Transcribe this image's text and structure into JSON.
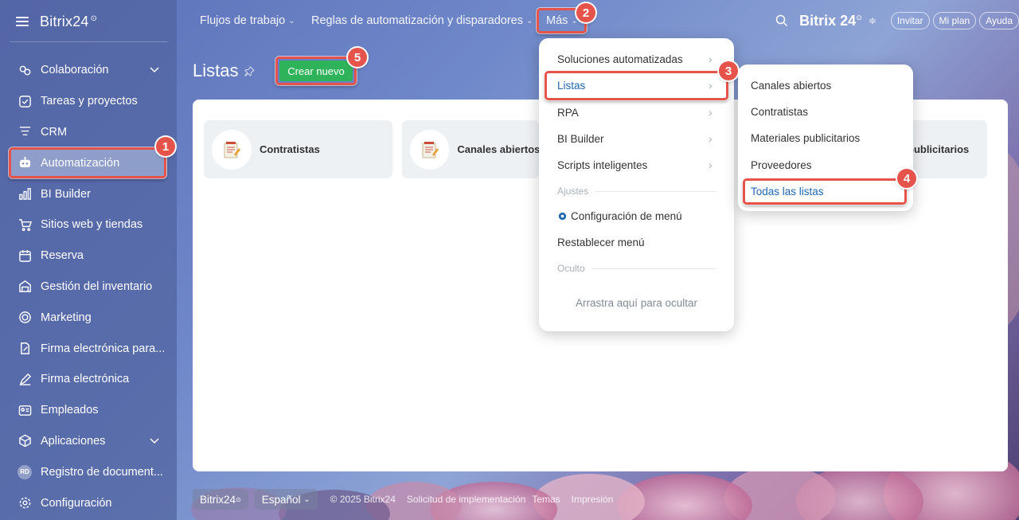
{
  "brand": {
    "name": "Bitrix24"
  },
  "sidebar": {
    "items": [
      {
        "label": "Colaboración",
        "icon": "chat-bubbles-icon"
      },
      {
        "label": "Tareas y proyectos",
        "icon": "checkbox-icon"
      },
      {
        "label": "CRM",
        "icon": "crm-filter-icon"
      },
      {
        "label": "Automatización",
        "icon": "robot-icon"
      },
      {
        "label": "BI Builder",
        "icon": "bar-chart-icon"
      },
      {
        "label": "Sitios web y tiendas",
        "icon": "cart-icon"
      },
      {
        "label": "Reserva",
        "icon": "calendar-icon"
      },
      {
        "label": "Gestión del inventario",
        "icon": "warehouse-icon"
      },
      {
        "label": "Marketing",
        "icon": "target-icon"
      },
      {
        "label": "Firma electrónica para...",
        "icon": "document-sign-icon"
      },
      {
        "label": "Firma electrónica",
        "icon": "pen-icon"
      },
      {
        "label": "Empleados",
        "icon": "id-card-icon"
      },
      {
        "label": "Aplicaciones",
        "icon": "cube-icon"
      },
      {
        "label": "Registro de document...",
        "icon": "rd-badge-icon",
        "badge": "RD"
      },
      {
        "label": "Configuración",
        "icon": "gear-icon"
      }
    ]
  },
  "topbar": {
    "links": [
      "Flujos de trabajo",
      "Reglas de automatización y disparadores",
      "Más"
    ],
    "brand": "Bitrix 24",
    "buttons": [
      "Invitar",
      "Mi plan",
      "Ayuda"
    ]
  },
  "page": {
    "title": "Listas",
    "create_label": "Crear nuevo"
  },
  "lists": [
    {
      "label": "Contratistas"
    },
    {
      "label": "Canales abiertos"
    },
    {
      "label": "publicitarios"
    }
  ],
  "menu": {
    "items": [
      {
        "label": "Soluciones automatizadas"
      },
      {
        "label": "Listas"
      },
      {
        "label": "RPA"
      },
      {
        "label": "BI Builder"
      },
      {
        "label": "Scripts inteligentes"
      }
    ],
    "section_settings": "Ajustes",
    "config_label": "Configuración de menú",
    "reset_label": "Restablecer menú",
    "section_hidden": "Oculto",
    "drag_hint": "Arrastra aquí para ocultar"
  },
  "submenu": {
    "items": [
      "Canales abiertos",
      "Contratistas",
      "Materiales publicitarios",
      "Proveedores",
      "Todas las listas"
    ]
  },
  "footer": {
    "brand": "Bitrix24",
    "language": "Español",
    "copyright": "© 2025 Bitrix24",
    "links": [
      "Solicitud de implementación",
      "Temas",
      "Impresión"
    ]
  },
  "steps": [
    "1",
    "2",
    "3",
    "4",
    "5"
  ],
  "colors": {
    "accent_green": "#2fb35a",
    "highlight_red": "#e5534b",
    "link_blue": "#2067b0"
  }
}
